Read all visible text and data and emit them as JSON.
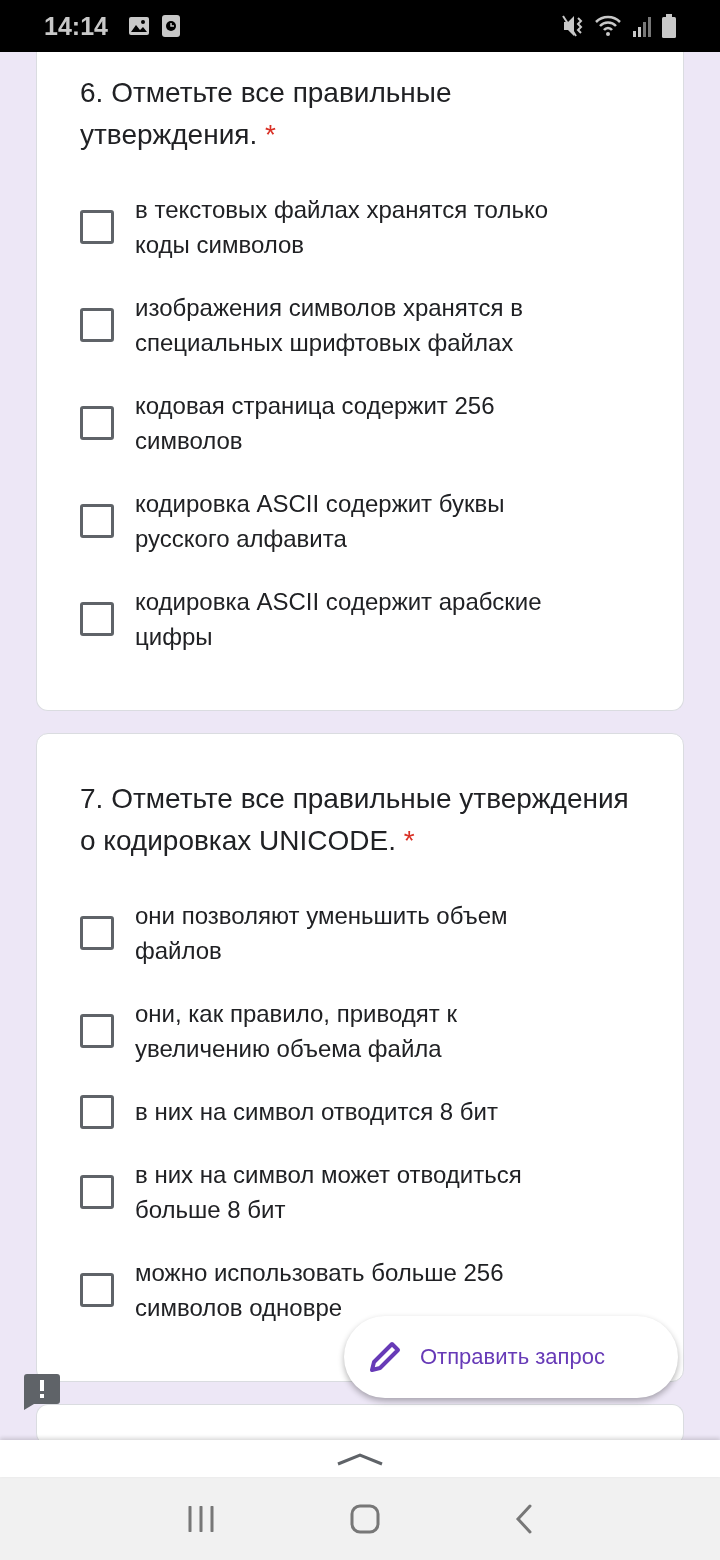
{
  "status_bar": {
    "time": "14:14"
  },
  "questions": [
    {
      "title": "6. Отметьте все правильные утверждения.",
      "required": true,
      "required_mark": "*",
      "options": [
        {
          "label": "в текстовых файлах хранятся только коды символов",
          "checked": false
        },
        {
          "label": "изображения символов хранятся в специальных шрифтовых файлах",
          "checked": false
        },
        {
          "label": "кодовая страница содержит 256 символов",
          "checked": false
        },
        {
          "label": "кодировка ASCII содержит буквы русского алфавита",
          "checked": false
        },
        {
          "label": "кодировка ASCII содержит арабские цифры",
          "checked": false
        }
      ]
    },
    {
      "title": "7. Отметьте все правильные утверждения о кодировках UNICODE.",
      "required": true,
      "required_mark": "*",
      "options": [
        {
          "label": "они позволяют уменьшить объем файлов",
          "checked": false
        },
        {
          "label": "они, как правило, приводят к увеличению объема файла",
          "checked": false
        },
        {
          "label": "в них на символ отводится 8 бит",
          "checked": false
        },
        {
          "label": "в них на символ может отводиться больше 8 бит",
          "checked": false
        },
        {
          "label": "можно использовать больше 256 символов одновре",
          "checked": false
        }
      ]
    }
  ],
  "submit_button": {
    "label": "Отправить запрос"
  }
}
